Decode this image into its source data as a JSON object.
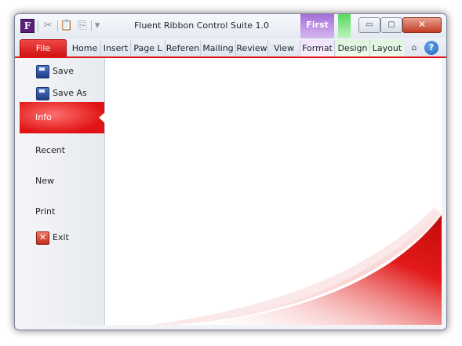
{
  "window": {
    "title": "Fluent Ribbon Control Suite 1.0",
    "app_icon_letter": "F",
    "controls": {
      "minimize": "▭",
      "maximize": "▢",
      "close": "✕"
    }
  },
  "quick_access": [
    {
      "icon": "cut-icon",
      "glyph": "✂"
    },
    {
      "icon": "paste-icon",
      "glyph": "📋"
    },
    {
      "icon": "copy-icon",
      "glyph": "⎘"
    },
    {
      "icon": "customize-dropdown-icon",
      "glyph": "▾"
    }
  ],
  "contextual_groups": {
    "first": "First",
    "second": ""
  },
  "tabs": {
    "file": "File",
    "items": [
      "Home",
      "Insert",
      "Page L",
      "Referen",
      "Mailing",
      "Review",
      "View",
      "Format",
      "Design",
      "Layout"
    ]
  },
  "ribbon_icons": {
    "collapse": "⌂",
    "help": "?"
  },
  "backstage": {
    "save": "Save",
    "save_as": "Save As",
    "info": "Info",
    "recent": "Recent",
    "new": "New",
    "print": "Print",
    "exit": "Exit"
  },
  "colors": {
    "accent": "#e01616",
    "first_group": "#a56ed6",
    "green_group": "#56d95c"
  }
}
